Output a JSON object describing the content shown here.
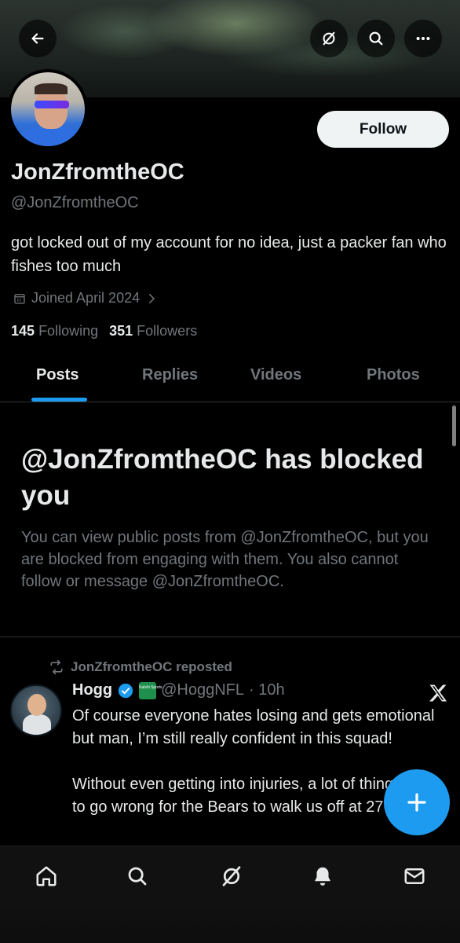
{
  "header": {
    "back_icon": "arrow-left-icon",
    "grok_icon": "slash-circle-icon",
    "search_icon": "search-icon",
    "more_icon": "more-horizontal-icon"
  },
  "profile": {
    "display_name": "JonZfromtheOC",
    "handle": "@JonZfromtheOC",
    "follow_label": "Follow",
    "bio": "got locked out of my account for no idea, just a packer fan who fishes too much",
    "joined": "Joined April 2024",
    "following_count": "145",
    "following_label": "Following",
    "followers_count": "351",
    "followers_label": "Followers"
  },
  "tabs": [
    {
      "label": "Posts",
      "active": true
    },
    {
      "label": "Replies",
      "active": false
    },
    {
      "label": "Videos",
      "active": false
    },
    {
      "label": "Photos",
      "active": false
    }
  ],
  "blocked_notice": {
    "title": "@JonZfromtheOC has blocked you",
    "text": "You can view public posts from @JonZfromtheOC, but you are blocked from engaging with them. You also cannot follow or message @JonZfromtheOC."
  },
  "post": {
    "repost_label": "JonZfromtheOC reposted",
    "author_name": "Hogg",
    "author_handle": "@HoggNFL",
    "time": "· 10h",
    "badge_text": "Kalshi Sports",
    "body": "Of course everyone hates losing and gets emotional but man, I’m still really confident in this squad!\n\nWithout even getting into injuries, a lot of things had to go wrong for the Bears to walk us off at 27-"
  },
  "colors": {
    "accent": "#1d9bf0",
    "muted_text": "#71767b",
    "primary_text": "#e7e9ea",
    "background": "#000000"
  },
  "bottom_nav": [
    "home-icon",
    "search-icon",
    "grok-icon",
    "notifications-icon",
    "messages-icon"
  ]
}
